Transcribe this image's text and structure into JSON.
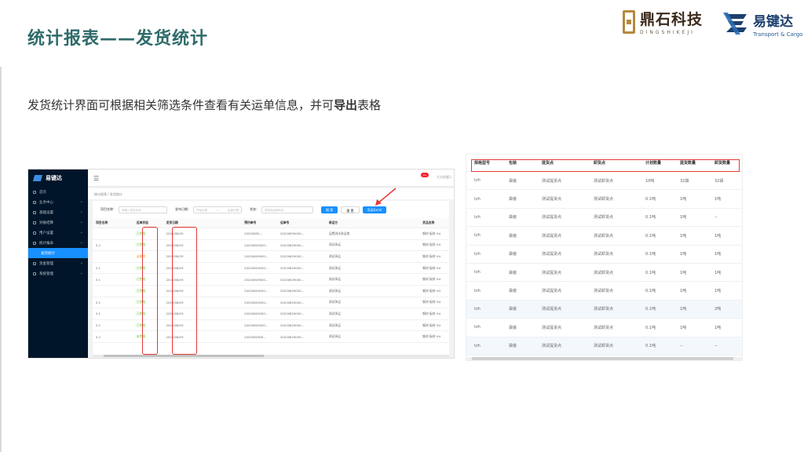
{
  "slide": {
    "title": "统计报表——发货统计",
    "description_prefix": "发货统计界面可根据相关筛选条件查看有关运单信息，并可",
    "description_bold": "导出",
    "description_suffix": "表格"
  },
  "logos": {
    "logo1_cn": "鼎石科技",
    "logo1_en": "DINGSHIKEJI",
    "logo2_cn": "易键达",
    "logo2_en": "Transport & Cargo"
  },
  "app": {
    "brand": "易键达",
    "sidebar": [
      {
        "label": "首页",
        "icon": "home-icon"
      },
      {
        "label": "业务中心",
        "icon": "briefcase-icon"
      },
      {
        "label": "基础设置",
        "icon": "settings-icon"
      },
      {
        "label": "对账结算",
        "icon": "calculator-icon"
      },
      {
        "label": "用户设置",
        "icon": "user-icon"
      },
      {
        "label": "统计报表",
        "icon": "chart-icon"
      },
      {
        "label": "发货统计",
        "icon": "",
        "active": true
      },
      {
        "label": "资金管理",
        "icon": "wallet-icon"
      },
      {
        "label": "系统管理",
        "icon": "system-icon"
      }
    ],
    "menu_icon": "☰",
    "badge": "9+",
    "user": "大大的超人",
    "breadcrumb": "统计报表 / 发货统计",
    "filters": {
      "project_label": "项目名称：",
      "project_placeholder": "请输入项目名称",
      "date_label": "发布日期：",
      "date_start": "开始日期",
      "date_sep": "→",
      "date_end": "结束日期",
      "status_label": "状态：",
      "status_placeholder": "请选择运单状态",
      "search_btn": "搜 索",
      "reset_btn": "重 置",
      "export_btn": "导出Excel"
    },
    "table_headers": [
      "项目名称",
      "运单状态",
      "发货日期",
      "预约单号",
      "运单号",
      "承运方",
      "货品名称"
    ],
    "table_rows": [
      [
        "",
        "已完成",
        "2020/06/30",
        "20200630…",
        "20200630000…",
        "运费测试承运商",
        "钢材 板材 H4"
      ],
      [
        "5.2",
        "已完成",
        "2020/06/29",
        "20200629000…",
        "20200629000…",
        "测试承运",
        "钢材 板材 H4"
      ],
      [
        "",
        "运输中",
        "2020/06/29",
        "20200629000…",
        "20200629000…",
        "测试承运",
        "钢材 板材 H4"
      ],
      [
        "5.1",
        "已完成",
        "2020/06/29",
        "20200629000…",
        "20200629000…",
        "测试承运",
        "钢材 板材 H4"
      ],
      [
        "5.1",
        "已完成",
        "2020/06/29",
        "20200629000…",
        "20200629000…",
        "测试承运",
        "钢材 板材 H4"
      ],
      [
        "",
        "已完成",
        "2020/06/29",
        "20200629000…",
        "20200629000…",
        "测试承运",
        "钢材 板材 H4"
      ],
      [
        "5.2",
        "已完成",
        "2020/06/29",
        "20200629000…",
        "20200629000…",
        "测试承运",
        "钢材 板材 H4"
      ],
      [
        "5.1",
        "已完成",
        "2020/06/29",
        "20200629000…",
        "20200629000…",
        "测试承运",
        "钢材 板材 H4"
      ],
      [
        "5.1",
        "已完成",
        "2020/06/29",
        "20200629000…",
        "20200629000…",
        "测试承运",
        "钢材 板材 H4"
      ],
      [
        "5.2",
        "未完成",
        "2020/06/29",
        "2020062900…",
        "20200629000…",
        "测试承运",
        "钢材 板材 H4"
      ]
    ]
  },
  "export_table": {
    "headers": [
      "规格型号",
      "包装",
      "提货点",
      "卸货点",
      "计划数量",
      "提货数量",
      "卸货数量"
    ],
    "rows": [
      [
        "tzh",
        "袋装",
        "测试提货点",
        "测试卸货点",
        "10吨",
        "32袋",
        "32袋"
      ],
      [
        "tzh",
        "袋装",
        "测试提货点",
        "测试卸货点",
        "0.1吨",
        "1吨",
        "1吨"
      ],
      [
        "tzh",
        "袋装",
        "测试提货点",
        "测试卸货点",
        "0.1吨",
        "1吨",
        "--"
      ],
      [
        "tzh",
        "袋装",
        "测试提货点",
        "测试卸货点",
        "0.1吨",
        "1吨",
        "1吨"
      ],
      [
        "tzh",
        "袋装",
        "测试提货点",
        "测试卸货点",
        "0.1吨",
        "1吨",
        "1吨"
      ],
      [
        "tzh",
        "袋装",
        "测试提货点",
        "测试卸货点",
        "0.1吨",
        "1吨",
        "1吨"
      ],
      [
        "tzh",
        "袋装",
        "测试提货点",
        "测试卸货点",
        "0.1吨",
        "1吨",
        "1吨"
      ],
      [
        "tzh",
        "袋装",
        "测试提货点",
        "测试卸货点",
        "0.1吨",
        "1吨",
        "2吨"
      ],
      [
        "tzh",
        "袋装",
        "测试提货点",
        "测试卸货点",
        "0.1吨",
        "1吨",
        "1吨"
      ],
      [
        "tzh",
        "袋装",
        "测试提货点",
        "测试卸货点",
        "0.1吨",
        "--",
        "--"
      ]
    ]
  },
  "colors": {
    "title": "#2e6b6a",
    "sidebar_bg": "#001529",
    "primary": "#1890ff",
    "highlight": "#e53935"
  }
}
